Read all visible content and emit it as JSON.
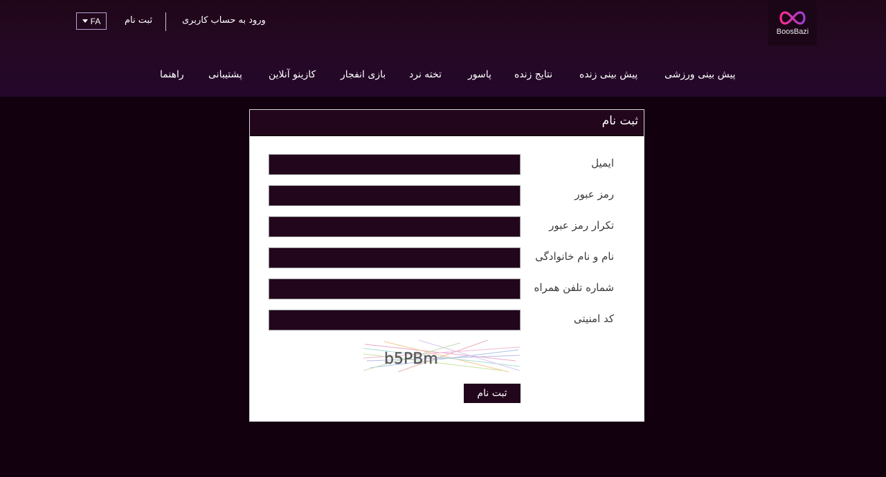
{
  "header": {
    "logo_text": "BoosBazi",
    "language": "FA",
    "register_link": "ثبت نام",
    "login_link": "ورود به حساب کاربری"
  },
  "nav": {
    "items": [
      {
        "label": "پیش بینی ورزشی"
      },
      {
        "label": "پیش بینی زنده"
      },
      {
        "label": "نتایج زنده"
      },
      {
        "label": "پاسور"
      },
      {
        "label": "تخته نرد"
      },
      {
        "label": "بازی انفجار"
      },
      {
        "label": "کازینو آنلاین"
      },
      {
        "label": "پشتیبانی"
      },
      {
        "label": "راهنما"
      }
    ]
  },
  "form": {
    "title": "ثبت نام",
    "fields": [
      {
        "label": "ایمیل",
        "value": ""
      },
      {
        "label": "رمز عبور",
        "value": ""
      },
      {
        "label": "تکرار رمز عبور",
        "value": ""
      },
      {
        "label": "نام و نام خانوادگی",
        "value": ""
      },
      {
        "label": "شماره تلفن همراه",
        "value": ""
      },
      {
        "label": "کد امنیتی",
        "value": ""
      }
    ],
    "captcha_text": "b5PBm",
    "submit_label": "ثبت نام"
  },
  "colors": {
    "header_bg": "#250826",
    "page_bg": "#12000f",
    "input_bg": "#22061c",
    "logo_pink": "#e0307f",
    "logo_purple": "#9b3fd6"
  }
}
